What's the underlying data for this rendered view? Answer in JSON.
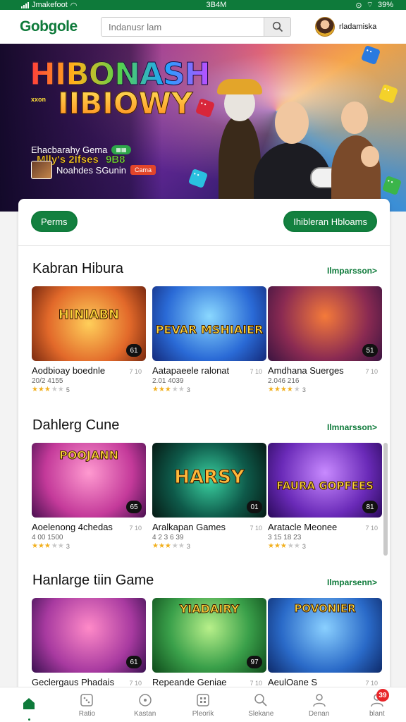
{
  "status_bar": {
    "carrier": "Jmakefoot",
    "time": "3B4M",
    "battery": "39%"
  },
  "header": {
    "logo": "Gobgole",
    "search_placeholder": "Indanusr lam",
    "username": "rladamiska"
  },
  "hero": {
    "title_line1": "HIBONASH",
    "title_small": "xxon",
    "title_line2": "IIBIOWY",
    "subtitle": "Mlly's 2Ifses",
    "subtitle_badge": "9B8",
    "row1_text": "Ehacbarahy Gema",
    "row2_text": "Noahdes SGunin",
    "row2_badge": "Cama"
  },
  "tabs": {
    "left": "Perms",
    "right": "Ihibleran Hbloams"
  },
  "sections": [
    {
      "title": "Kabran Hibura",
      "link": "Ilmparsson>",
      "games": [
        {
          "name": "Aodbioay boednle",
          "meta": "7 10",
          "number": "20/2 4155",
          "badge": "61",
          "rating": 3,
          "count": "5",
          "art": "HINIABN"
        },
        {
          "name": "Aatapaeele ralonat",
          "meta": "7 10",
          "number": "2.01 4039",
          "badge": "",
          "rating": 3,
          "count": "3",
          "art": "PEVAR MSHIAIER"
        },
        {
          "name": "Amdhana Suerges",
          "meta": "7 10",
          "number": "2.046 216",
          "badge": "51",
          "rating": 4,
          "count": "3",
          "art": ""
        }
      ]
    },
    {
      "title": "Dahlerg Cune",
      "link": "Ilmnarsson>",
      "games": [
        {
          "name": "Aoelenong 4chedas",
          "meta": "7 10",
          "number": "4 00 1500",
          "badge": "65",
          "rating": 3,
          "count": "3",
          "art": "POOJANN"
        },
        {
          "name": "Aralkapan Games",
          "meta": "7 10",
          "number": "4 2 3 6 39",
          "badge": "01",
          "rating": 3,
          "count": "3",
          "art": "HARSY"
        },
        {
          "name": "Aratacle Meonee",
          "meta": "7 10",
          "number": "3 15 18 23",
          "badge": "81",
          "rating": 3,
          "count": "3",
          "art": "FAURA GOPFEES"
        }
      ]
    },
    {
      "title": "Hanlarge tiin Game",
      "link": "Ilmparsenn>",
      "games": [
        {
          "name": "Geclergaus Phadais",
          "meta": "7 10",
          "number": "",
          "badge": "61",
          "rating": 0,
          "count": "",
          "art": ""
        },
        {
          "name": "Repeande Geniae",
          "meta": "7 10",
          "number": "",
          "badge": "97",
          "rating": 0,
          "count": "",
          "art": "YIADAIRY"
        },
        {
          "name": "AeulOane S",
          "meta": "7 10",
          "number": "",
          "badge": "",
          "rating": 0,
          "count": "",
          "art": "POVONIER"
        }
      ]
    }
  ],
  "bottom_nav": [
    {
      "label": "",
      "icon": "home-icon"
    },
    {
      "label": "Ratio",
      "icon": "dice-icon"
    },
    {
      "label": "Kastan",
      "icon": "compass-icon"
    },
    {
      "label": "Pleorik",
      "icon": "grid-icon"
    },
    {
      "label": "Slekane",
      "icon": "search-icon"
    },
    {
      "label": "Denan",
      "icon": "user-icon"
    },
    {
      "label": "blant",
      "icon": "profile-icon",
      "notification": "39"
    }
  ],
  "colors": {
    "brand_green": "#0e7a3a",
    "star": "#f2b01e",
    "notification": "#e8262a"
  }
}
